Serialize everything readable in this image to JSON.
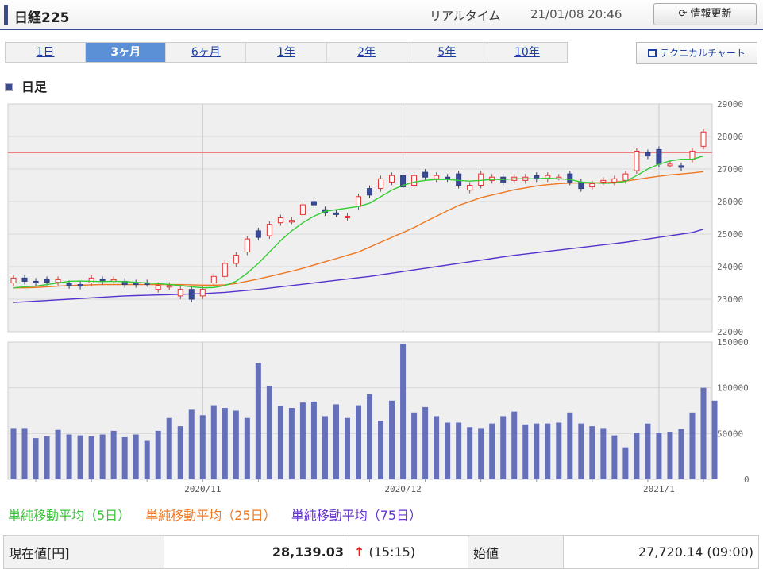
{
  "header": {
    "title": "日経225",
    "realtime_label": "リアルタイム",
    "timestamp": "21/01/08 20:46",
    "refresh_label": "情報更新"
  },
  "tabs": [
    {
      "label": "1日",
      "active": false
    },
    {
      "label": "3ヶ月",
      "active": true
    },
    {
      "label": "6ヶ月",
      "active": false
    },
    {
      "label": "1年",
      "active": false
    },
    {
      "label": "2年",
      "active": false
    },
    {
      "label": "5年",
      "active": false
    },
    {
      "label": "10年",
      "active": false
    }
  ],
  "technical_chart_label": "テクニカルチャート",
  "section_title": "日足",
  "legend": [
    {
      "label": "単純移動平均（5日）",
      "color": "#3ac43a"
    },
    {
      "label": "単純移動平均（25日）",
      "color": "#ee7722"
    },
    {
      "label": "単純移動平均（75日）",
      "color": "#6633cc"
    }
  ],
  "table": {
    "current_label": "現在値[円]",
    "current_value": "28,139.03",
    "change_arrow": "↑",
    "change_time": "(15:15)",
    "open_label": "始値",
    "open_value": "27,720.14 (09:00)"
  },
  "chart_data": {
    "type": "candlestick",
    "price_axis": {
      "ylim": [
        22000,
        29000
      ],
      "ticks": [
        "29000",
        "28000",
        "27000",
        "26000",
        "25000",
        "24000",
        "23000",
        "22000"
      ]
    },
    "volume_axis": {
      "ylim": [
        0,
        150000
      ],
      "ticks": [
        "150000",
        "100000",
        "50000",
        "0"
      ]
    },
    "x_labels": [
      {
        "label": "2020/11",
        "index": 17
      },
      {
        "label": "2020/12",
        "index": 35
      },
      {
        "label": "2021/1",
        "index": 58
      }
    ],
    "reference_line": 27500,
    "candles": [
      {
        "o": 23500,
        "c": 23650
      },
      {
        "o": 23650,
        "c": 23550
      },
      {
        "o": 23550,
        "c": 23500
      },
      {
        "o": 23600,
        "c": 23520
      },
      {
        "o": 23520,
        "c": 23600
      },
      {
        "o": 23480,
        "c": 23420
      },
      {
        "o": 23450,
        "c": 23400
      },
      {
        "o": 23500,
        "c": 23650
      },
      {
        "o": 23600,
        "c": 23550
      },
      {
        "o": 23580,
        "c": 23600
      },
      {
        "o": 23550,
        "c": 23450
      },
      {
        "o": 23500,
        "c": 23450
      },
      {
        "o": 23500,
        "c": 23480
      },
      {
        "o": 23300,
        "c": 23420
      },
      {
        "o": 23380,
        "c": 23420
      },
      {
        "o": 23100,
        "c": 23300
      },
      {
        "o": 23300,
        "c": 23000
      },
      {
        "o": 23100,
        "c": 23300
      },
      {
        "o": 23500,
        "c": 23700
      },
      {
        "o": 23700,
        "c": 24100
      },
      {
        "o": 24100,
        "c": 24350
      },
      {
        "o": 24450,
        "c": 24850
      },
      {
        "o": 25100,
        "c": 24900
      },
      {
        "o": 24950,
        "c": 25300
      },
      {
        "o": 25350,
        "c": 25500
      },
      {
        "o": 25400,
        "c": 25420
      },
      {
        "o": 25600,
        "c": 25900
      },
      {
        "o": 26000,
        "c": 25900
      },
      {
        "o": 25750,
        "c": 25650
      },
      {
        "o": 25650,
        "c": 25620
      },
      {
        "o": 25500,
        "c": 25550
      },
      {
        "o": 25850,
        "c": 26150
      },
      {
        "o": 26400,
        "c": 26200
      },
      {
        "o": 26400,
        "c": 26700
      },
      {
        "o": 26600,
        "c": 26800
      },
      {
        "o": 26800,
        "c": 26450
      },
      {
        "o": 26500,
        "c": 26800
      },
      {
        "o": 26900,
        "c": 26750
      },
      {
        "o": 26700,
        "c": 26800
      },
      {
        "o": 26750,
        "c": 26700
      },
      {
        "o": 26850,
        "c": 26500
      },
      {
        "o": 26350,
        "c": 26500
      },
      {
        "o": 26500,
        "c": 26850
      },
      {
        "o": 26650,
        "c": 26750
      },
      {
        "o": 26750,
        "c": 26600
      },
      {
        "o": 26650,
        "c": 26750
      },
      {
        "o": 26650,
        "c": 26750
      },
      {
        "o": 26800,
        "c": 26700
      },
      {
        "o": 26700,
        "c": 26800
      },
      {
        "o": 26750,
        "c": 26750
      },
      {
        "o": 26850,
        "c": 26600
      },
      {
        "o": 26600,
        "c": 26400
      },
      {
        "o": 26450,
        "c": 26550
      },
      {
        "o": 26600,
        "c": 26650
      },
      {
        "o": 26600,
        "c": 26700
      },
      {
        "o": 26650,
        "c": 26850
      },
      {
        "o": 26950,
        "c": 27550
      },
      {
        "o": 27500,
        "c": 27400
      },
      {
        "o": 27600,
        "c": 27150
      },
      {
        "o": 27150,
        "c": 27150
      },
      {
        "o": 27100,
        "c": 27050
      },
      {
        "o": 27300,
        "c": 27550
      },
      {
        "o": 27700,
        "c": 28140
      }
    ],
    "volumes": [
      56000,
      56000,
      45000,
      47000,
      54000,
      49000,
      48000,
      47000,
      49000,
      53000,
      46000,
      49000,
      42000,
      53000,
      67000,
      58000,
      76000,
      70000,
      81000,
      78000,
      75000,
      67000,
      127000,
      102000,
      80000,
      78000,
      84000,
      85000,
      69000,
      82000,
      67000,
      81000,
      93000,
      64000,
      86000,
      148000,
      73000,
      79000,
      69000,
      62000,
      62000,
      57000,
      56000,
      61000,
      69000,
      74000,
      60000,
      61000,
      61000,
      62000,
      73000,
      61000,
      58000,
      56000,
      48000,
      35000,
      51000,
      61000,
      51000,
      52000,
      55000,
      73000,
      100000,
      86000
    ],
    "ma5": [
      23350,
      23380,
      23400,
      23450,
      23500,
      23550,
      23560,
      23550,
      23540,
      23550,
      23540,
      23520,
      23500,
      23480,
      23450,
      23420,
      23380,
      23350,
      23360,
      23420,
      23550,
      23800,
      24100,
      24450,
      24800,
      25100,
      25350,
      25550,
      25700,
      25750,
      25800,
      25850,
      25950,
      26150,
      26350,
      26500,
      26600,
      26650,
      26680,
      26680,
      26650,
      26630,
      26650,
      26680,
      26680,
      26700,
      26700,
      26700,
      26720,
      26700,
      26680,
      26600,
      26580,
      26560,
      26570,
      26620,
      26800,
      27000,
      27150,
      27250,
      27300,
      27300,
      27400
    ],
    "ma25": [
      23350,
      23350,
      23360,
      23380,
      23400,
      23420,
      23430,
      23440,
      23450,
      23450,
      23450,
      23450,
      23450,
      23450,
      23450,
      23450,
      23440,
      23430,
      23430,
      23440,
      23480,
      23550,
      23620,
      23700,
      23780,
      23860,
      23950,
      24050,
      24150,
      24250,
      24350,
      24450,
      24600,
      24750,
      24900,
      25050,
      25200,
      25380,
      25550,
      25720,
      25880,
      26000,
      26120,
      26200,
      26280,
      26360,
      26420,
      26480,
      26520,
      26550,
      26570,
      26570,
      26570,
      26580,
      26600,
      26630,
      26680,
      26730,
      26780,
      26820,
      26850,
      26880,
      26920
    ],
    "ma75": [
      22900,
      22920,
      22940,
      22960,
      22980,
      23000,
      23020,
      23040,
      23060,
      23080,
      23100,
      23110,
      23120,
      23130,
      23140,
      23150,
      23160,
      23170,
      23190,
      23210,
      23240,
      23270,
      23300,
      23340,
      23380,
      23420,
      23460,
      23500,
      23540,
      23580,
      23620,
      23660,
      23700,
      23750,
      23800,
      23850,
      23900,
      23950,
      24000,
      24050,
      24100,
      24150,
      24200,
      24250,
      24300,
      24350,
      24390,
      24430,
      24470,
      24510,
      24550,
      24590,
      24630,
      24670,
      24710,
      24750,
      24800,
      24850,
      24900,
      24950,
      25000,
      25050,
      25150
    ]
  }
}
